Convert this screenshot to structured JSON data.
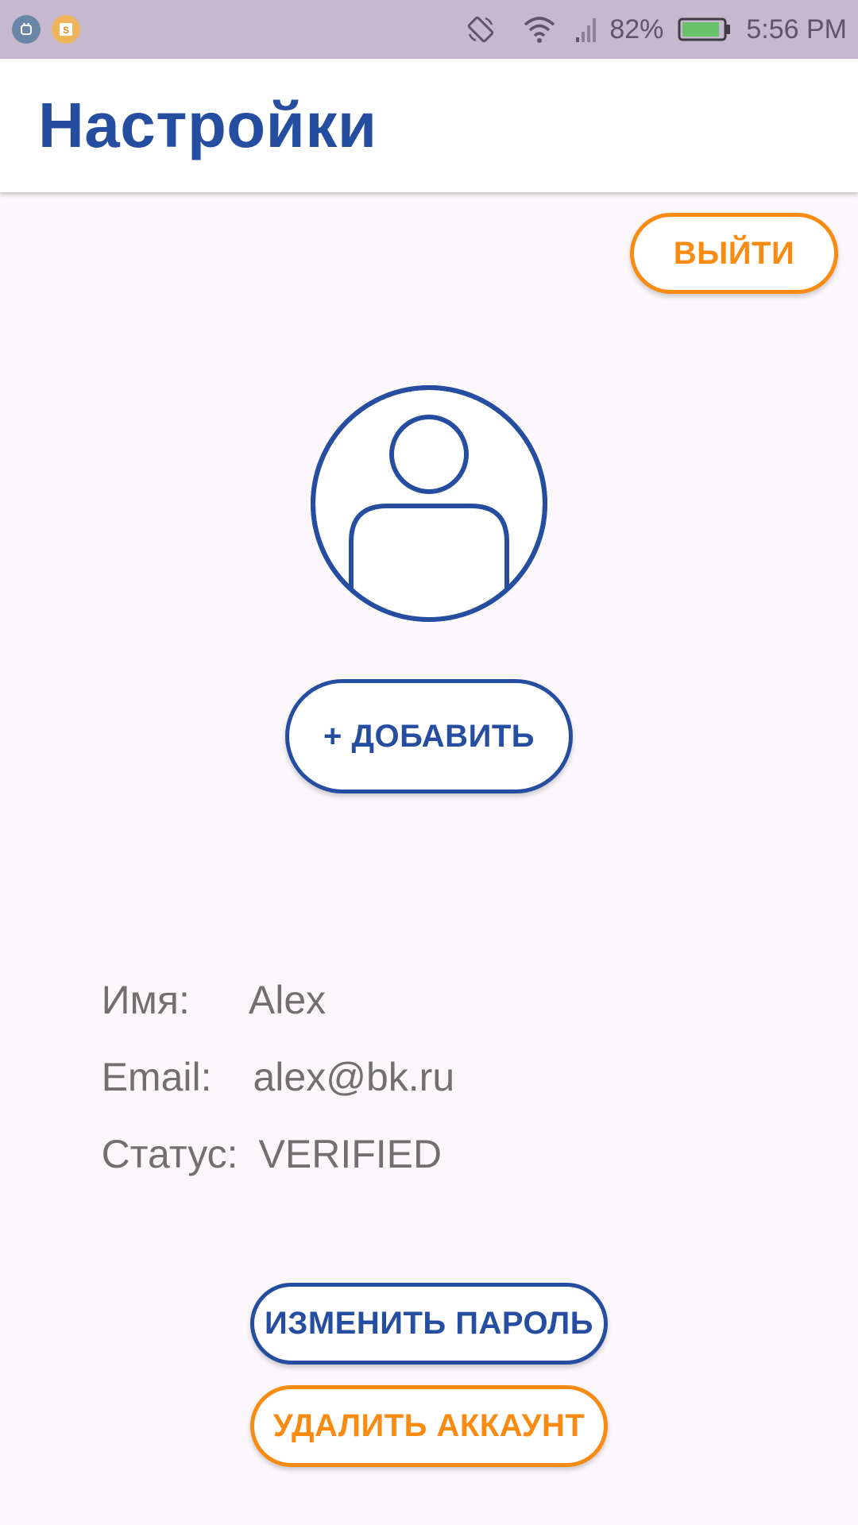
{
  "status_bar": {
    "battery_percent": "82%",
    "time": "5:56 PM",
    "icons": [
      "android-debug-icon",
      "app-notification-icon",
      "auto-rotate-icon",
      "wifi-icon",
      "cellular-signal-icon",
      "battery-icon"
    ]
  },
  "header": {
    "title": "Настройки"
  },
  "actions": {
    "logout_label": "ВЫЙТИ",
    "add_photo_label": "+ ДОБАВИТЬ",
    "change_password_label": "ИЗМЕНИТЬ ПАРОЛЬ",
    "delete_account_label": "УДАЛИТЬ АККАУНТ"
  },
  "profile": {
    "avatar_icon": "user-avatar-icon",
    "name_label": "Имя:",
    "name_value": "Alex",
    "email_label": "Email:",
    "email_value": "alex@bk.ru",
    "status_label": "Статус:",
    "status_value": "VERIFIED"
  },
  "colors": {
    "primary_blue": "#254da0",
    "accent_orange": "#fa8b12",
    "status_bar_bg": "#c6b9cf",
    "screen_bg": "#fcf7fb",
    "info_text": "#707070"
  }
}
